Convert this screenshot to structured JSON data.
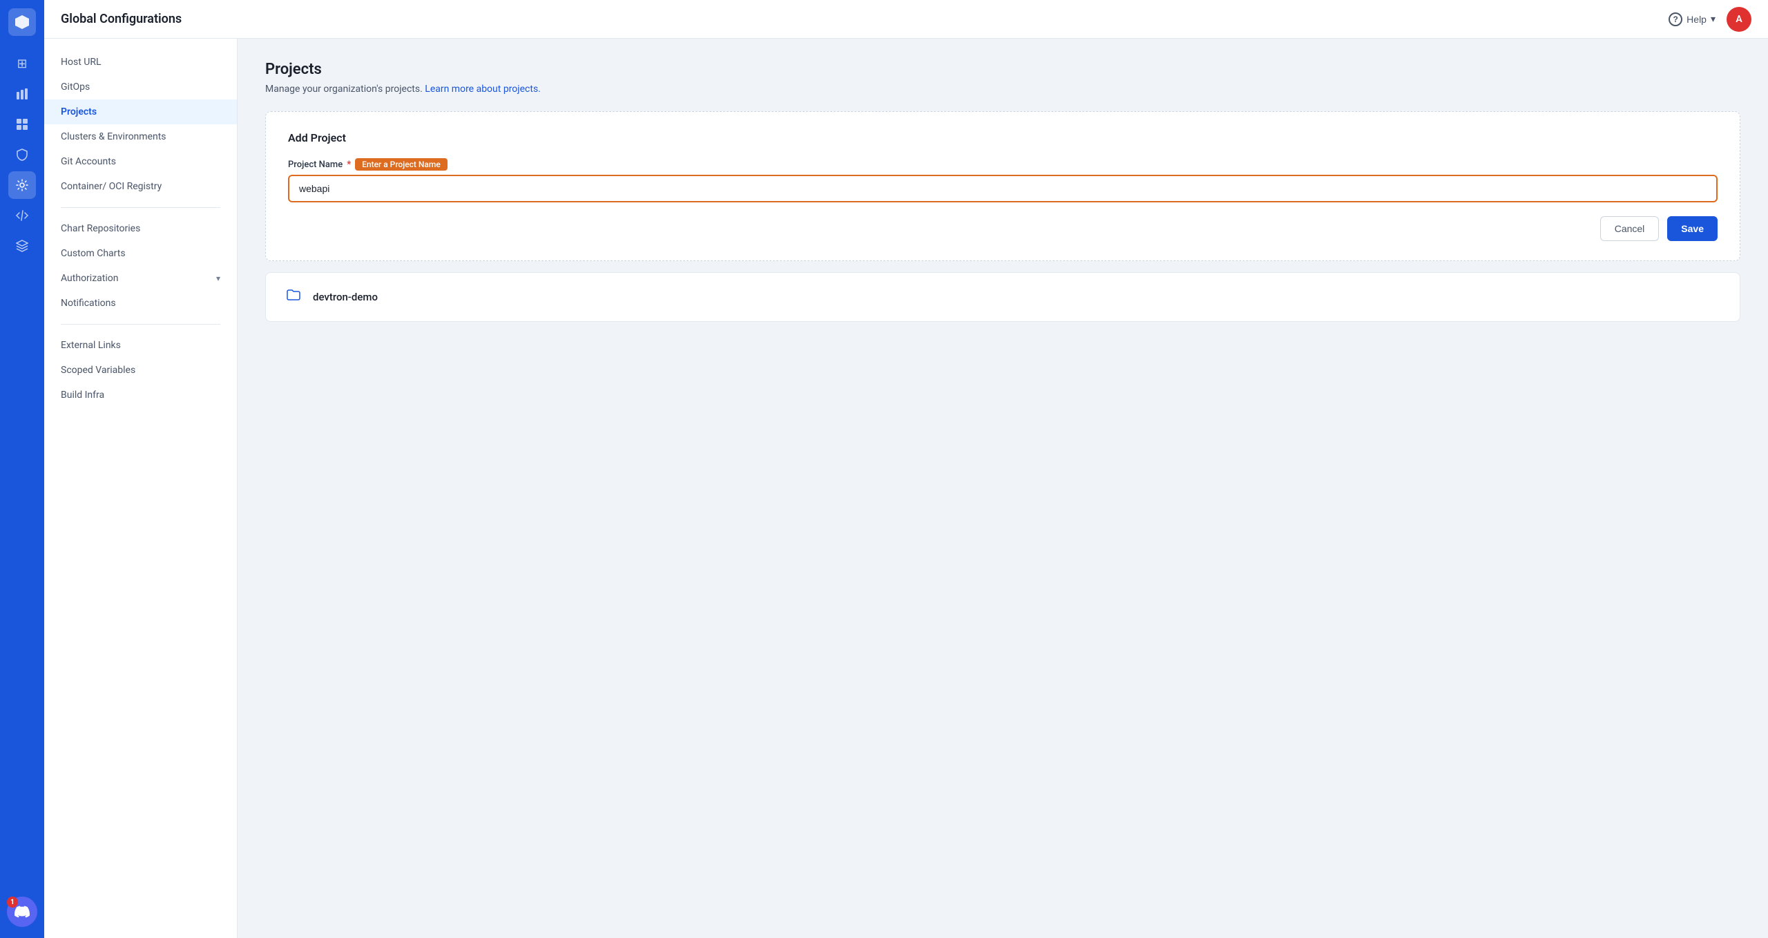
{
  "header": {
    "title": "Global Configurations",
    "help_label": "Help",
    "avatar_initial": "A"
  },
  "icon_sidebar": {
    "icons": [
      {
        "name": "grid-icon",
        "symbol": "⊞",
        "active": false
      },
      {
        "name": "chart-icon",
        "symbol": "▦",
        "active": false
      },
      {
        "name": "table-icon",
        "symbol": "⊟",
        "active": false
      },
      {
        "name": "cube-icon",
        "symbol": "◈",
        "active": false
      },
      {
        "name": "gear-icon",
        "symbol": "⚙",
        "active": true
      },
      {
        "name": "code-icon",
        "symbol": "</>",
        "active": false
      },
      {
        "name": "layers-icon",
        "symbol": "≡",
        "active": false
      }
    ],
    "discord_badge": "1"
  },
  "nav_sidebar": {
    "items": [
      {
        "id": "host-url",
        "label": "Host URL",
        "active": false,
        "has_chevron": false
      },
      {
        "id": "gitops",
        "label": "GitOps",
        "active": false,
        "has_chevron": false
      },
      {
        "id": "projects",
        "label": "Projects",
        "active": true,
        "has_chevron": false
      },
      {
        "id": "clusters",
        "label": "Clusters & Environments",
        "active": false,
        "has_chevron": false
      },
      {
        "id": "git-accounts",
        "label": "Git Accounts",
        "active": false,
        "has_chevron": false
      },
      {
        "id": "container-registry",
        "label": "Container/ OCI Registry",
        "active": false,
        "has_chevron": false
      },
      {
        "id": "chart-repositories",
        "label": "Chart Repositories",
        "active": false,
        "has_chevron": false
      },
      {
        "id": "custom-charts",
        "label": "Custom Charts",
        "active": false,
        "has_chevron": false
      },
      {
        "id": "authorization",
        "label": "Authorization",
        "active": false,
        "has_chevron": true
      },
      {
        "id": "notifications",
        "label": "Notifications",
        "active": false,
        "has_chevron": false
      },
      {
        "id": "external-links",
        "label": "External Links",
        "active": false,
        "has_chevron": false
      },
      {
        "id": "scoped-variables",
        "label": "Scoped Variables",
        "active": false,
        "has_chevron": false
      },
      {
        "id": "build-infra",
        "label": "Build Infra",
        "active": false,
        "has_chevron": false
      }
    ]
  },
  "main": {
    "section_title": "Projects",
    "section_desc": "Manage your organization's projects.",
    "learn_more_text": "Learn more about projects.",
    "learn_more_url": "#",
    "add_project": {
      "card_title": "Add Project",
      "field_label": "Project Name",
      "field_required": "*",
      "tooltip_text": "Enter a Project Name",
      "input_value": "webapi",
      "input_placeholder": "Enter a Project Name",
      "cancel_label": "Cancel",
      "save_label": "Save"
    },
    "projects": [
      {
        "id": "devtron-demo",
        "name": "devtron-demo"
      }
    ]
  }
}
